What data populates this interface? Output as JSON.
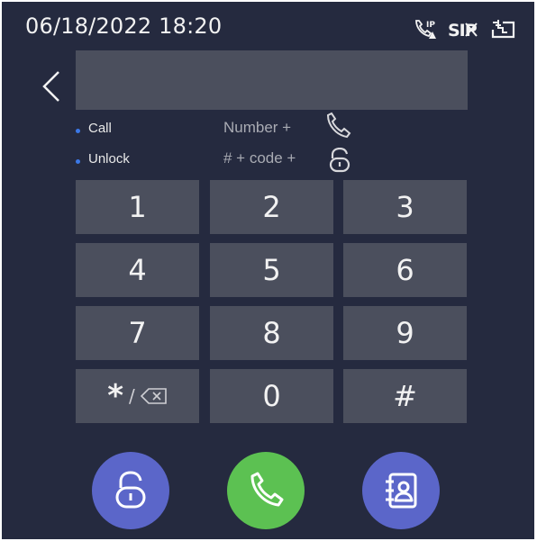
{
  "status_bar": {
    "datetime": "06/18/2022 18:20",
    "icons": [
      "ip-warning-icon",
      "sip-error-icon",
      "sd-card-icon"
    ]
  },
  "input": {
    "value": "",
    "placeholder": ""
  },
  "hints": [
    {
      "label": "Call",
      "formula": "Number +",
      "icon": "phone-icon"
    },
    {
      "label": "Unlock",
      "formula": "# + code +",
      "icon": "unlock-icon"
    }
  ],
  "keypad": {
    "keys": [
      "1",
      "2",
      "3",
      "4",
      "5",
      "6",
      "7",
      "8",
      "9",
      "*",
      "0",
      "#"
    ],
    "star_separator": "/",
    "star_secondary_icon": "backspace-icon"
  },
  "actions": {
    "unlock_icon": "unlock-icon",
    "call_icon": "phone-icon",
    "contacts_icon": "contacts-icon"
  },
  "colors": {
    "background": "#252a3f",
    "key_background": "#4b4f5d",
    "accent_blue": "#5b66c9",
    "call_green": "#5cc152",
    "hint_dot": "#3b78e7"
  }
}
